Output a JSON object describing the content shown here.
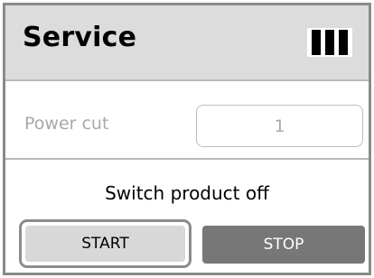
{
  "header": {
    "title": "Service",
    "status_icon": "signal-bars-icon"
  },
  "field": {
    "label": "Power cut",
    "value": "1"
  },
  "message": "Switch product off",
  "buttons": {
    "start_label": "START",
    "stop_label": "STOP"
  },
  "colors": {
    "header_bg": "#dcdcdc",
    "stop_bg": "#777777",
    "start_bg": "#d8d8d8",
    "border": "#8a8a8a"
  }
}
